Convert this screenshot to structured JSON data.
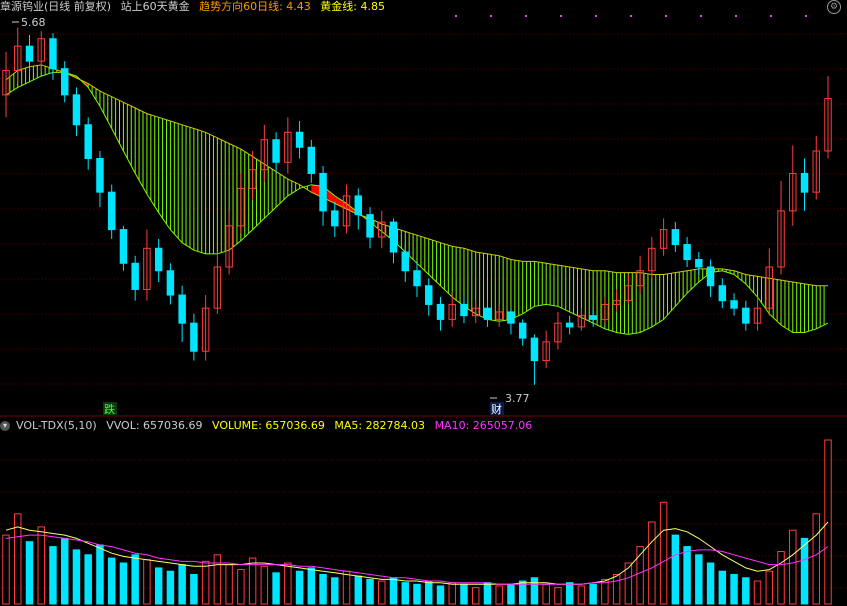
{
  "header": {
    "stock_label": "章源钨业(日线 前复权)",
    "indicator_name": "站上60天黄金",
    "trend_label": "趋势方向60日线:",
    "trend_value": "4.43",
    "gold_label": "黄金线:",
    "gold_value": "4.85"
  },
  "volume_header": {
    "title": "VOL-TDX(5,10)",
    "vvol_label": "VVOL:",
    "vvol_value": "657036.69",
    "volume_label": "VOLUME:",
    "volume_value": "657036.69",
    "ma5_label": "MA5:",
    "ma5_value": "282784.03",
    "ma10_label": "MA10:",
    "ma10_value": "265057.06"
  },
  "annotations": {
    "high_label": "5.68",
    "low_label": "3.77",
    "marker_die": "跌",
    "marker_cai": "财"
  },
  "colors": {
    "up": "#ff3c3c",
    "down": "#00e5ff",
    "band_green": "#7cfc00",
    "band_red": "#ff0000",
    "ma5": "#ffff66",
    "ma10": "#ff33ff",
    "grid": "#5a0000",
    "header_orange": "#ff9900",
    "header_yellow": "#ffff00",
    "header_magenta": "#ff33ff"
  },
  "chart_data": {
    "type": "candlestick",
    "price_range": [
      3.77,
      5.68
    ],
    "trend_line_60": [
      5.32,
      5.36,
      5.39,
      5.42,
      5.44,
      5.44,
      5.42,
      5.36,
      5.26,
      5.14,
      5.02,
      4.9,
      4.79,
      4.69,
      4.6,
      4.53,
      4.49,
      4.47,
      4.47,
      4.49,
      4.54,
      4.6,
      4.66,
      4.72,
      4.78,
      4.82,
      4.84,
      4.83,
      4.78,
      4.74,
      4.69,
      4.64,
      4.59,
      4.54,
      4.48,
      4.42,
      4.36,
      4.3,
      4.24,
      4.19,
      4.15,
      4.12,
      4.11,
      4.12,
      4.15,
      4.19,
      4.2,
      4.19,
      4.16,
      4.13,
      4.1,
      4.07,
      4.05,
      4.04,
      4.05,
      4.08,
      4.12,
      4.19,
      4.26,
      4.32,
      4.37,
      4.38,
      4.36,
      4.31,
      4.24,
      4.15,
      4.09,
      4.05,
      4.05,
      4.07,
      4.1
    ],
    "gold_line": [
      5.4,
      5.45,
      5.47,
      5.48,
      5.46,
      5.44,
      5.41,
      5.38,
      5.34,
      5.31,
      5.28,
      5.25,
      5.22,
      5.2,
      5.18,
      5.16,
      5.14,
      5.12,
      5.09,
      5.06,
      5.03,
      4.99,
      4.95,
      4.91,
      4.87,
      4.84,
      4.8,
      4.77,
      4.74,
      4.71,
      4.68,
      4.66,
      4.63,
      4.61,
      4.59,
      4.57,
      4.55,
      4.53,
      4.51,
      4.5,
      4.48,
      4.47,
      4.46,
      4.44,
      4.43,
      4.43,
      4.42,
      4.41,
      4.4,
      4.39,
      4.38,
      4.38,
      4.37,
      4.37,
      4.37,
      4.36,
      4.36,
      4.37,
      4.38,
      4.39,
      4.39,
      4.39,
      4.38,
      4.36,
      4.35,
      4.34,
      4.33,
      4.32,
      4.31,
      4.3,
      4.3
    ],
    "candles": [
      [
        5.32,
        5.45,
        5.2,
        5.55
      ],
      [
        5.45,
        5.58,
        5.38,
        5.68
      ],
      [
        5.58,
        5.5,
        5.42,
        5.64
      ],
      [
        5.5,
        5.62,
        5.45,
        5.66
      ],
      [
        5.62,
        5.46,
        5.4,
        5.65
      ],
      [
        5.46,
        5.32,
        5.28,
        5.5
      ],
      [
        5.32,
        5.16,
        5.1,
        5.36
      ],
      [
        5.16,
        4.98,
        4.92,
        5.2
      ],
      [
        4.98,
        4.8,
        4.72,
        5.02
      ],
      [
        4.8,
        4.6,
        4.55,
        4.84
      ],
      [
        4.6,
        4.42,
        4.38,
        4.62
      ],
      [
        4.42,
        4.28,
        4.22,
        4.46
      ],
      [
        4.28,
        4.5,
        4.22,
        4.6
      ],
      [
        4.5,
        4.38,
        4.32,
        4.55
      ],
      [
        4.38,
        4.25,
        4.2,
        4.42
      ],
      [
        4.25,
        4.1,
        4.0,
        4.3
      ],
      [
        4.1,
        3.95,
        3.9,
        4.15
      ],
      [
        3.95,
        4.18,
        3.9,
        4.25
      ],
      [
        4.18,
        4.4,
        4.15,
        4.48
      ],
      [
        4.4,
        4.62,
        4.36,
        4.7
      ],
      [
        4.62,
        4.82,
        4.58,
        4.9
      ],
      [
        4.82,
        4.92,
        4.76,
        5.02
      ],
      [
        4.92,
        5.08,
        4.86,
        5.16
      ],
      [
        5.08,
        4.96,
        4.9,
        5.12
      ],
      [
        4.96,
        5.12,
        4.9,
        5.2
      ],
      [
        5.12,
        5.04,
        4.98,
        5.18
      ],
      [
        5.04,
        4.9,
        4.85,
        5.08
      ],
      [
        4.9,
        4.7,
        4.62,
        4.94
      ],
      [
        4.7,
        4.62,
        4.56,
        4.75
      ],
      [
        4.62,
        4.78,
        4.58,
        4.84
      ],
      [
        4.78,
        4.68,
        4.6,
        4.82
      ],
      [
        4.68,
        4.56,
        4.5,
        4.72
      ],
      [
        4.56,
        4.64,
        4.5,
        4.7
      ],
      [
        4.64,
        4.48,
        4.42,
        4.66
      ],
      [
        4.48,
        4.38,
        4.32,
        4.52
      ],
      [
        4.38,
        4.3,
        4.24,
        4.42
      ],
      [
        4.3,
        4.2,
        4.14,
        4.34
      ],
      [
        4.2,
        4.12,
        4.06,
        4.24
      ],
      [
        4.12,
        4.2,
        4.08,
        4.26
      ],
      [
        4.2,
        4.14,
        4.1,
        4.24
      ],
      [
        4.14,
        4.18,
        4.1,
        4.22
      ],
      [
        4.18,
        4.12,
        4.08,
        4.22
      ],
      [
        4.12,
        4.16,
        4.08,
        4.2
      ],
      [
        4.16,
        4.1,
        4.04,
        4.18
      ],
      [
        4.1,
        4.02,
        3.98,
        4.12
      ],
      [
        4.02,
        3.9,
        3.77,
        4.04
      ],
      [
        3.9,
        4.0,
        3.86,
        4.06
      ],
      [
        4.0,
        4.1,
        3.96,
        4.16
      ],
      [
        4.1,
        4.08,
        4.04,
        4.14
      ],
      [
        4.08,
        4.14,
        4.06,
        4.18
      ],
      [
        4.14,
        4.12,
        4.08,
        4.18
      ],
      [
        4.12,
        4.2,
        4.1,
        4.24
      ],
      [
        4.2,
        4.22,
        4.16,
        4.28
      ],
      [
        4.22,
        4.3,
        4.2,
        4.36
      ],
      [
        4.3,
        4.38,
        4.26,
        4.46
      ],
      [
        4.38,
        4.5,
        4.34,
        4.56
      ],
      [
        4.5,
        4.6,
        4.46,
        4.66
      ],
      [
        4.6,
        4.52,
        4.48,
        4.64
      ],
      [
        4.52,
        4.44,
        4.4,
        4.56
      ],
      [
        4.44,
        4.4,
        4.36,
        4.48
      ],
      [
        4.4,
        4.3,
        4.24,
        4.44
      ],
      [
        4.3,
        4.22,
        4.18,
        4.34
      ],
      [
        4.22,
        4.18,
        4.14,
        4.26
      ],
      [
        4.18,
        4.1,
        4.06,
        4.22
      ],
      [
        4.1,
        4.18,
        4.06,
        4.24
      ],
      [
        4.18,
        4.4,
        4.14,
        4.5
      ],
      [
        4.4,
        4.7,
        4.36,
        4.86
      ],
      [
        4.7,
        4.9,
        4.62,
        5.05
      ],
      [
        4.9,
        4.8,
        4.7,
        4.98
      ],
      [
        4.8,
        5.02,
        4.76,
        5.1
      ],
      [
        5.02,
        5.3,
        4.98,
        5.42
      ]
    ],
    "volumes": [
      0.42,
      0.55,
      0.38,
      0.47,
      0.35,
      0.4,
      0.33,
      0.3,
      0.36,
      0.28,
      0.25,
      0.3,
      0.27,
      0.22,
      0.2,
      0.24,
      0.18,
      0.26,
      0.3,
      0.24,
      0.21,
      0.28,
      0.23,
      0.19,
      0.25,
      0.2,
      0.22,
      0.18,
      0.16,
      0.2,
      0.17,
      0.15,
      0.14,
      0.16,
      0.13,
      0.12,
      0.14,
      0.11,
      0.13,
      0.12,
      0.1,
      0.13,
      0.11,
      0.12,
      0.14,
      0.16,
      0.12,
      0.1,
      0.13,
      0.11,
      0.12,
      0.15,
      0.18,
      0.25,
      0.35,
      0.5,
      0.62,
      0.42,
      0.35,
      0.3,
      0.25,
      0.2,
      0.18,
      0.16,
      0.14,
      0.2,
      0.32,
      0.45,
      0.4,
      0.55,
      1.0
    ],
    "ma5": [
      0.45,
      0.47,
      0.45,
      0.44,
      0.43,
      0.42,
      0.4,
      0.37,
      0.34,
      0.31,
      0.29,
      0.28,
      0.27,
      0.26,
      0.25,
      0.24,
      0.23,
      0.23,
      0.24,
      0.24,
      0.24,
      0.25,
      0.25,
      0.24,
      0.23,
      0.22,
      0.21,
      0.2,
      0.19,
      0.18,
      0.17,
      0.16,
      0.15,
      0.15,
      0.14,
      0.14,
      0.13,
      0.13,
      0.12,
      0.12,
      0.12,
      0.12,
      0.12,
      0.12,
      0.13,
      0.13,
      0.13,
      0.12,
      0.12,
      0.12,
      0.13,
      0.14,
      0.17,
      0.22,
      0.3,
      0.38,
      0.45,
      0.46,
      0.44,
      0.4,
      0.35,
      0.3,
      0.26,
      0.22,
      0.2,
      0.21,
      0.25,
      0.3,
      0.36,
      0.42,
      0.5
    ],
    "ma10": [
      0.4,
      0.41,
      0.42,
      0.42,
      0.41,
      0.4,
      0.39,
      0.38,
      0.36,
      0.35,
      0.33,
      0.31,
      0.3,
      0.28,
      0.27,
      0.26,
      0.26,
      0.25,
      0.25,
      0.25,
      0.24,
      0.24,
      0.24,
      0.24,
      0.24,
      0.23,
      0.23,
      0.22,
      0.21,
      0.2,
      0.19,
      0.18,
      0.17,
      0.16,
      0.16,
      0.15,
      0.14,
      0.14,
      0.13,
      0.13,
      0.13,
      0.13,
      0.12,
      0.12,
      0.12,
      0.12,
      0.12,
      0.12,
      0.12,
      0.12,
      0.13,
      0.13,
      0.14,
      0.16,
      0.19,
      0.22,
      0.26,
      0.3,
      0.32,
      0.33,
      0.33,
      0.32,
      0.3,
      0.28,
      0.26,
      0.24,
      0.24,
      0.25,
      0.27,
      0.3,
      0.35
    ]
  }
}
